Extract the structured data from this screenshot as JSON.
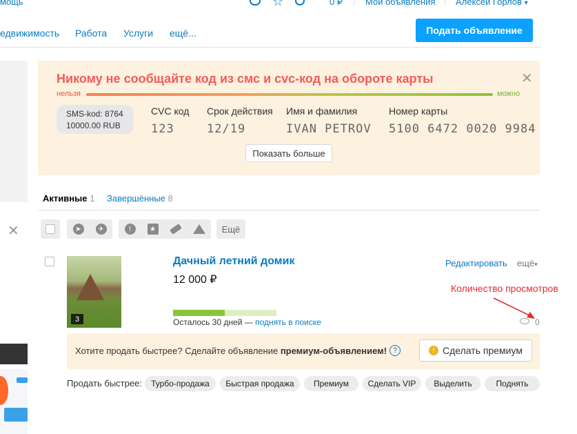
{
  "topbar": {
    "left_text": "мощь",
    "price": "0 ₽",
    "my_ads": "Мои объявления",
    "user": "Алексей Горлов"
  },
  "nav": {
    "items": [
      "едвижимость",
      "Работа",
      "Услуги",
      "ещё..."
    ],
    "post_button": "Подать объявление"
  },
  "warning": {
    "title": "Никому не сообщайте код из смс и cvc-код на обороте карты",
    "label_bad": "нельзя",
    "label_ok": "можно",
    "sms_line1": "SMS-kod: 8764",
    "sms_line2": "10000.00 RUB",
    "columns": [
      {
        "header": "CVC код",
        "value": "123"
      },
      {
        "header": "Срок действия",
        "value": "12/19"
      },
      {
        "header": "Имя и фамилия",
        "value": "IVAN PETROV"
      },
      {
        "header": "Номер карты",
        "value": "5100 6472 0020 9984"
      }
    ],
    "show_more": "Показать больше"
  },
  "tabs": {
    "active_label": "Активные",
    "active_count": "1",
    "finished_label": "Завершённые",
    "finished_count": "8"
  },
  "toolbar": {
    "more": "Ещё"
  },
  "listing": {
    "photo_count": "3",
    "title": "Дачный летний домик",
    "price": "12 000 ₽",
    "progress_fraction": 0.5,
    "days_left": "Осталось 30 дней —",
    "raise_link": "поднять в поиске",
    "edit": "Редактировать",
    "more": "ещё",
    "annotation": "Количество просмотров",
    "views": "0"
  },
  "premium": {
    "text_plain": "Хотите продать быстрее? Сделайте объявление ",
    "text_bold": "премиум-объявлением!",
    "button": "Сделать премиум"
  },
  "sell_faster": {
    "label": "Продать быстрее:",
    "options": [
      "Турбо-продажа",
      "Быстрая продажа",
      "Премиум",
      "Сделать VIP",
      "Выделить",
      "Поднять"
    ]
  },
  "colors": {
    "link": "#0a7bc1",
    "primary_button": "#0aa1ff",
    "warning_title": "#f35b5b",
    "annotation": "#e32b2b",
    "progress": "#8ac43c"
  }
}
